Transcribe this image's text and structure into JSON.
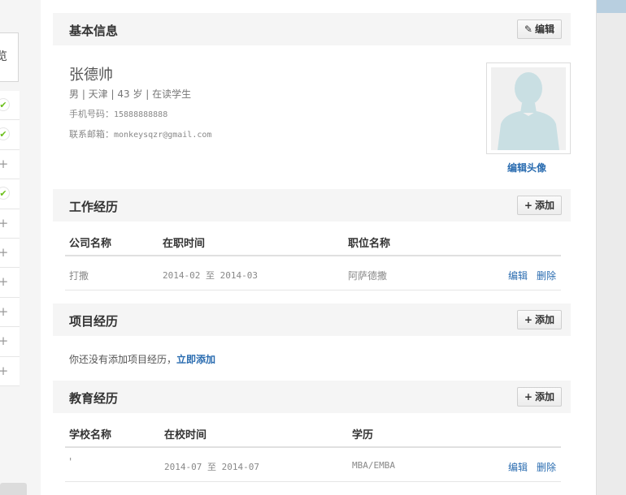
{
  "left_rail": {
    "card_text": "览",
    "items": [
      {
        "state": "check",
        "glyph": "✔"
      },
      {
        "state": "check",
        "glyph": "✔"
      },
      {
        "state": "plus",
        "glyph": "+"
      },
      {
        "state": "check",
        "glyph": "✔"
      },
      {
        "state": "plus",
        "glyph": "+"
      },
      {
        "state": "plus",
        "glyph": "+"
      },
      {
        "state": "plus",
        "glyph": "+"
      },
      {
        "state": "plus",
        "glyph": "+"
      },
      {
        "state": "plus",
        "glyph": "+"
      },
      {
        "state": "plus",
        "glyph": "+"
      }
    ]
  },
  "basic": {
    "title": "基本信息",
    "edit_label": "编辑",
    "edit_icon": "✎",
    "name": "张德帅",
    "meta": "男 | 天津 | 43 岁 | 在读学生",
    "phone_label": "手机号码：",
    "phone": "15888888888",
    "email_label": "联系邮箱：",
    "email": "monkeysqzr@gmail.com",
    "avatar_edit": "编辑头像"
  },
  "work": {
    "title": "工作经历",
    "add_label": "添加",
    "add_icon": "+",
    "headers": [
      "公司名称",
      "在职时间",
      "职位名称"
    ],
    "rows": [
      {
        "company": "打撒",
        "period": "2014-02 至 2014-03",
        "position": "阿萨德撒",
        "edit": "编辑",
        "delete": "删除"
      }
    ]
  },
  "project": {
    "title": "项目经历",
    "add_label": "添加",
    "add_icon": "+",
    "empty_text": "你还没有添加项目经历，",
    "empty_link": "立即添加"
  },
  "education": {
    "title": "教育经历",
    "add_label": "添加",
    "add_icon": "+",
    "headers": [
      "学校名称",
      "在校时间",
      "学历"
    ],
    "rows": [
      {
        "school": "'",
        "period": "2014-07 至 2014-07",
        "degree": "MBA/EMBA",
        "edit": "编辑",
        "delete": "删除"
      }
    ]
  },
  "colors": {
    "link": "#2a6cb0",
    "check": "#6cbf1c",
    "section_bg": "#f5f5f5"
  }
}
